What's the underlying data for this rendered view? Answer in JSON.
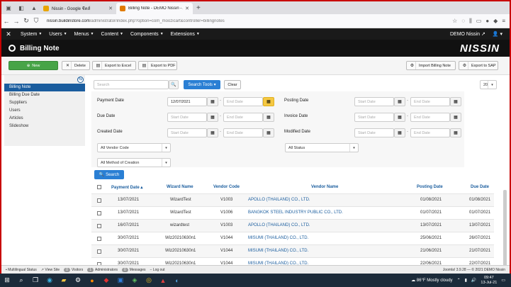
{
  "browser": {
    "tabs": [
      {
        "title": "Nissin - Google ชีตส์",
        "active": false,
        "color": "#e8a500"
      },
      {
        "title": "Billing Note - DEMO Nissin - A",
        "active": true,
        "color": "#e07a00"
      }
    ],
    "url_host": "nissin.buildinstore.com",
    "url_rest": "/administrator/index.php?option=com_moozicart&controller=billingnotes"
  },
  "admin_menu": {
    "items": [
      "System",
      "Users",
      "Menus",
      "Content",
      "Components",
      "Extensions"
    ],
    "user": "DEMO Nissin"
  },
  "page": {
    "title": "Billing Note",
    "brand": "NISSIN"
  },
  "toolbar": {
    "new": "New",
    "delete": "Delete",
    "export_excel": "Export to Excel",
    "export_pdf": "Export to PDF",
    "import": "Import Billing Note",
    "export_sap": "Export to SAP"
  },
  "sidebar": {
    "items": [
      "Billing Note",
      "Billing Due Date",
      "Suppliers",
      "Users",
      "Articles",
      "Slideshow"
    ]
  },
  "search": {
    "placeholder": "Search",
    "tools": "Search Tools",
    "clear": "Clear",
    "limit": "20"
  },
  "filters": {
    "payment_date": "Payment Date",
    "payment_start": "12/07/2021",
    "end_date": "End Date",
    "start_date": "Start Date",
    "due_date": "Due Date",
    "created_date": "Created Date",
    "posting_date": "Posting Date",
    "invoice_date": "Invoice Date",
    "modified_date": "Modified Date",
    "vendor_code": "All Vendor Code",
    "status": "All Status",
    "method": "All Method of Creation",
    "search_btn": "Search"
  },
  "table": {
    "headers": [
      "Payment Date",
      "Wizard Name",
      "Vendor Code",
      "Vendor Name",
      "Posting Date",
      "Due Date"
    ],
    "rows": [
      [
        "13/07/2021",
        "WizardTest",
        "V1003",
        "APOLLO (THAILAND) CO., LTD.",
        "01/08/2021",
        "01/08/2021"
      ],
      [
        "13/07/2021",
        "WizardTest",
        "V1006",
        "BANGKOK STEEL INDUSTRY PUBLIC CO., LTD.",
        "01/07/2021",
        "01/07/2021"
      ],
      [
        "16/07/2021",
        "wizardtest",
        "V1003",
        "APOLLO (THAILAND) CO., LTD.",
        "13/07/2021",
        "13/07/2021"
      ],
      [
        "30/07/2021",
        "Wiz20210630n1",
        "V1044",
        "MISUMI (THAILAND) CO., LTD.",
        "25/06/2021",
        "26/07/2021"
      ],
      [
        "30/07/2021",
        "Wiz20210630n1",
        "V1044",
        "MISUMI (THAILAND) CO., LTD.",
        "21/06/2021",
        "21/07/2021"
      ],
      [
        "30/07/2021",
        "Wiz20210630n1",
        "V1044",
        "MISUMI (THAILAND) CO., LTD.",
        "22/06/2021",
        "22/07/2021"
      ]
    ]
  },
  "status_bar": {
    "multilingual": "Multilingual Status",
    "view_site": "View Site",
    "visitors": "Visitors",
    "visitors_count": "0",
    "admins": "Administrators",
    "admins_count": "1",
    "messages": "Messages",
    "messages_count": "0",
    "logout": "Log out",
    "footer": "Joomla! 3.9.28 — © 2021 DEMO Nissin"
  },
  "taskbar": {
    "weather": "86°F  Mostly cloudy",
    "time": "09:47",
    "date": "13-Jul-21"
  }
}
